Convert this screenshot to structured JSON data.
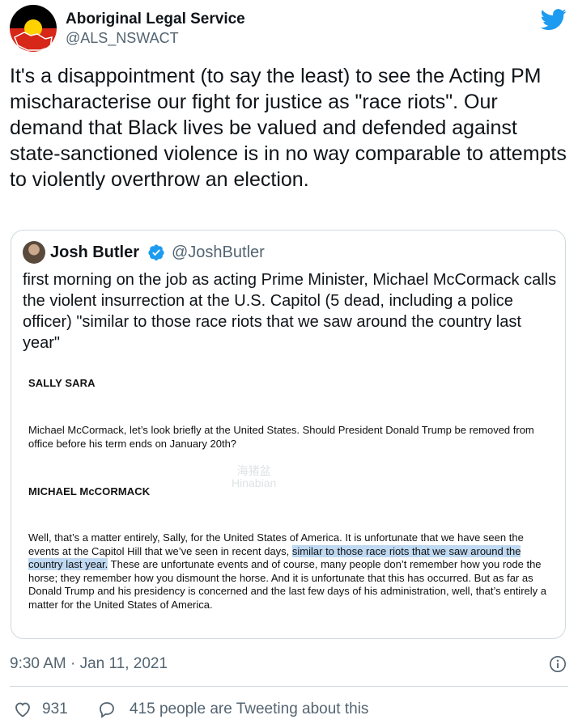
{
  "author": {
    "name": "Aboriginal Legal Service",
    "handle": "@ALS_NSWACT"
  },
  "tweet": {
    "text": "It's a disappointment (to say the least) to see the Acting PM mischaracterise our fight for justice as \"race riots\". Our demand that Black lives be valued and defended against state-sanctioned violence is in no way comparable to attempts to violently overthrow an election."
  },
  "quoted_tweet": {
    "author_name": "Josh Butler",
    "author_handle": "@JoshButler",
    "verified": true,
    "text": "first morning on the job as acting Prime Minister, Michael McCormack calls the violent insurrection at the U.S. Capitol (5 dead, including a police officer) \"similar to those race riots that we saw around the country last year\"",
    "transcript": {
      "speaker1": "SALLY SARA",
      "para1": "Michael McCormack, let’s look briefly at the United States. Should President Donald Trump be removed from office before his term ends on January 20th?",
      "speaker2": "MICHAEL McCORMACK",
      "para2_before": "Well, that’s a matter entirely, Sally, for the United States of America. It is unfortunate that we have seen the events at the Capitol Hill that we’ve seen in recent days, ",
      "para2_highlight": "similar to those race riots that we saw around the country last year.",
      "para2_after": " These are unfortunate events and of course, many people don’t remember how you rode the horse; they remember how you dismount the horse. And it is unfortunate that this has occurred. But as far as Donald Trump and his presidency is concerned and the last few days of his administration, well, that’s entirely a matter for the United States of America."
    },
    "watermark_line1": "海猪盆",
    "watermark_line2": "Hinabian"
  },
  "meta": {
    "timestamp": "9:30 AM · Jan 11, 2021"
  },
  "actions": {
    "like_count": "931",
    "reply_text": "415 people are Tweeting about this"
  },
  "colors": {
    "twitter_blue": "#1d9bf0",
    "secondary_text": "#536471",
    "highlight": "#bfd9f2",
    "aboriginal_flag_black": "#000000",
    "aboriginal_flag_red": "#d62718",
    "aboriginal_flag_yellow": "#ffd200"
  },
  "icons": {
    "logo": "twitter-bird-icon",
    "verified": "verified-badge-icon",
    "info": "info-icon",
    "like": "heart-icon",
    "reply": "speech-bubble-icon"
  }
}
